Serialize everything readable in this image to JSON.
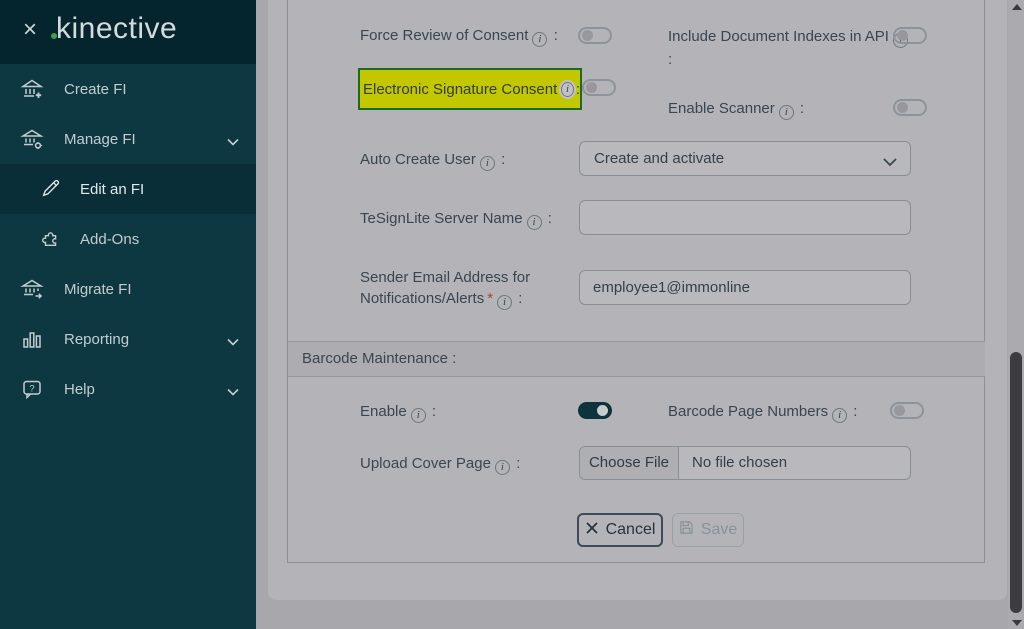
{
  "colors": {
    "accent_green": "#3fa142",
    "highlight_bg": "#c2c700",
    "highlight_border": "#1a6b1f",
    "toggle_on": "#0f333c",
    "sidebar_bg": "#0d3842",
    "sidebar_header_bg": "#04252d"
  },
  "sidebar": {
    "close_glyph": "×",
    "logo_text": "kinective",
    "items": [
      {
        "label": "Create FI",
        "icon": "bank-plus-icon"
      },
      {
        "label": "Manage FI",
        "icon": "bank-gear-icon",
        "expandable": true
      },
      {
        "label": "Edit an FI",
        "icon": "pencil-icon",
        "active": true
      },
      {
        "label": "Add-Ons",
        "icon": "puzzle-icon"
      },
      {
        "label": "Migrate FI",
        "icon": "bank-arrow-icon"
      },
      {
        "label": "Reporting",
        "icon": "bar-chart-icon",
        "expandable": true
      },
      {
        "label": "Help",
        "icon": "help-bubble-icon",
        "expandable": true
      }
    ]
  },
  "form": {
    "info_glyph": "i",
    "colon": ":",
    "fields": {
      "force_review": {
        "label": "Force Review of Consent",
        "toggle": "off"
      },
      "include_doc_indexes": {
        "label": "Include Document Indexes in API",
        "toggle": "off"
      },
      "esign_consent": {
        "label": "Electronic Signature Consent",
        "toggle": "off",
        "highlighted": true
      },
      "enable_scanner": {
        "label": "Enable Scanner",
        "toggle": "off"
      },
      "auto_create_user": {
        "label": "Auto Create User",
        "value": "Create and activate"
      },
      "tesignlite": {
        "label": "TeSignLite Server Name",
        "value": ""
      },
      "sender_email": {
        "label_line1": "Sender Email Address for",
        "label_line2": "Notifications/Alerts",
        "required_mark": "*",
        "value": "employee1@immonline"
      }
    },
    "barcode_section": {
      "title": "Barcode Maintenance :",
      "enable": {
        "label": "Enable",
        "toggle": "on"
      },
      "page_numbers": {
        "label": "Barcode Page Numbers",
        "toggle": "off"
      },
      "upload_cover": {
        "label": "Upload Cover Page",
        "button": "Choose File",
        "status": "No file chosen"
      }
    },
    "actions": {
      "cancel": "Cancel",
      "save": "Save"
    }
  }
}
